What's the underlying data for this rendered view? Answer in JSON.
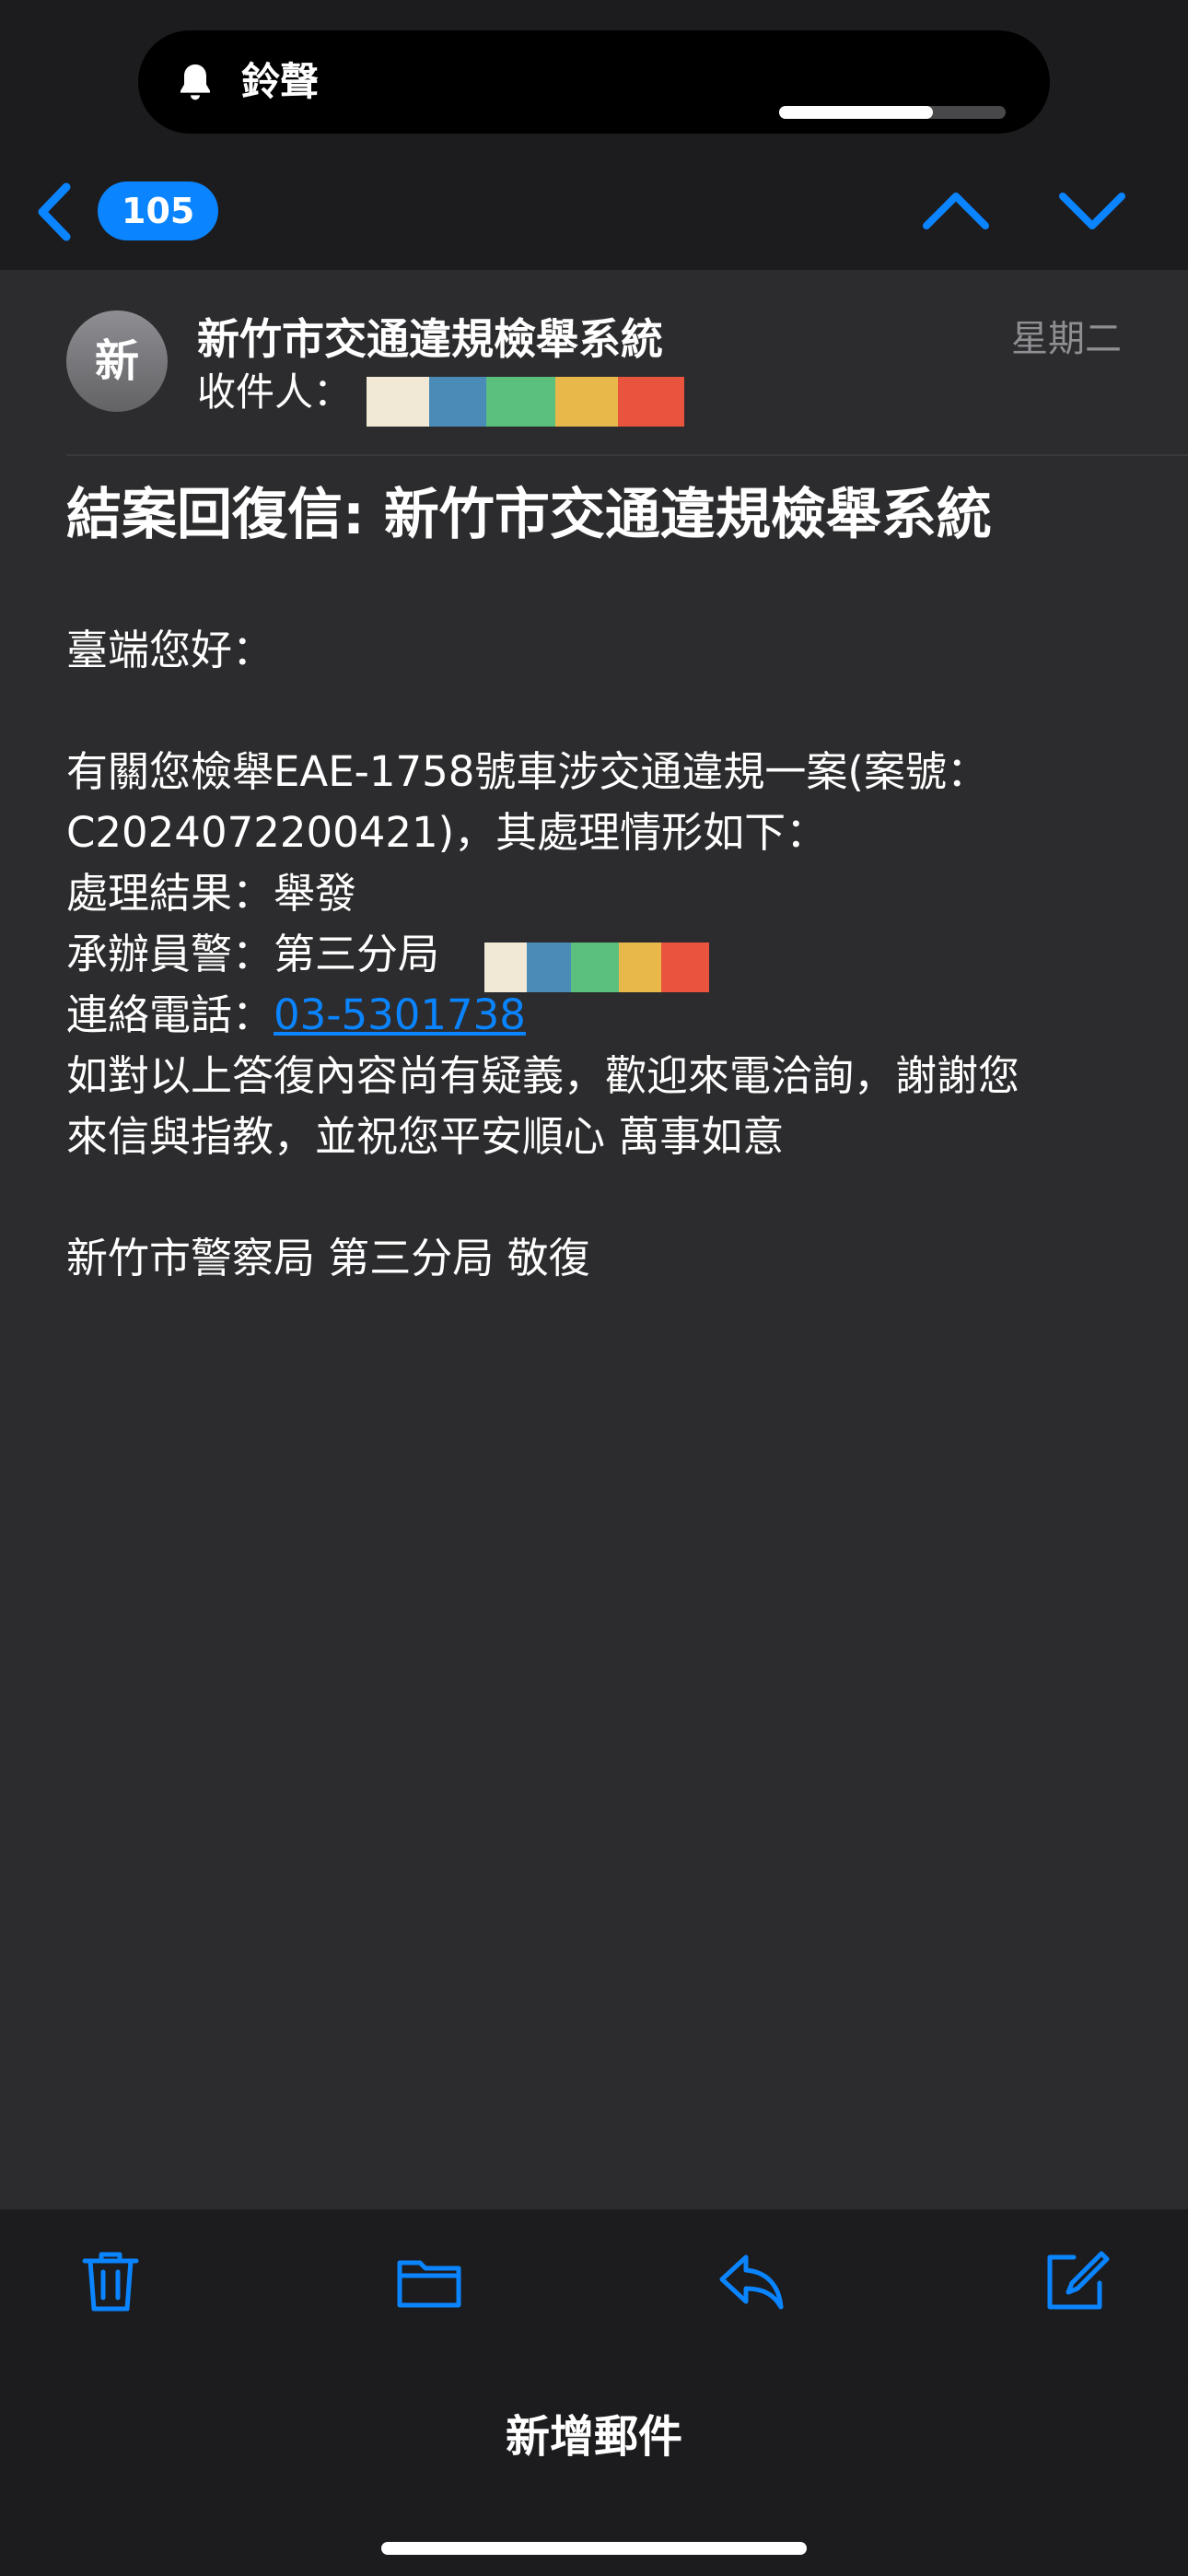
{
  "status": {
    "ringer_label": "鈴聲",
    "volume_level": 0.68
  },
  "nav": {
    "unread_count": "105"
  },
  "message": {
    "avatar_initial": "新",
    "sender": "新竹市交通違規檢舉系統",
    "recipient_label": "收件人：",
    "date": "星期二",
    "subject": "結案回復信: 新竹市交通違規檢舉系統",
    "greeting": "臺端您好：",
    "line1": "有關您檢舉EAE-1758號車涉交通違規一案(案號：",
    "line2": "C2024072200421)，其處理情形如下：",
    "result": "處理結果：舉發",
    "officer_label": "承辦員警：第三分局",
    "phone_label": "連絡電話：",
    "phone_number": "03-5301738",
    "closing1": "如對以上答復內容尚有疑義，歡迎來電洽詢，謝謝您",
    "closing2": "來信與指教，並祝您平安順心 萬事如意",
    "signature": "新竹市警察局 第三分局 敬復"
  },
  "compose": {
    "label": "新增郵件"
  },
  "colors": {
    "accent": "#0a84ff",
    "redaction": [
      "#f2e8d6",
      "#4a8bb8",
      "#5bbf7d",
      "#e8b84a",
      "#e8543e"
    ]
  },
  "icons": {
    "ringer": "bell-icon",
    "back": "chevron-left-icon",
    "previous": "chevron-up-icon",
    "next": "chevron-down-icon",
    "delete": "trash-icon",
    "move": "folder-icon",
    "reply": "reply-icon",
    "compose": "compose-icon"
  }
}
